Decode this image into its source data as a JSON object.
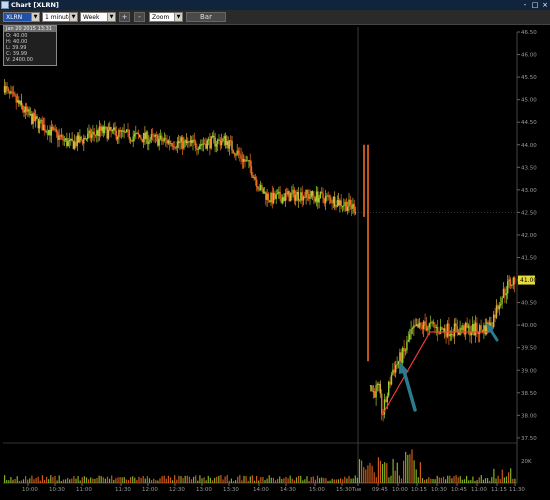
{
  "window": {
    "title": "Chart [XLRN]",
    "controls": [
      "-",
      "□",
      "×"
    ]
  },
  "toolbar": {
    "symbol": "XLRN",
    "interval": "1 minute",
    "range": "Week",
    "plus_label": "+",
    "minus_label": "-",
    "zoom": "Zoom",
    "bar_button": "Bar"
  },
  "ohlc": {
    "header": "Jan 20 2015 13:31",
    "open": "O: 40.00",
    "high": "H: 40.00",
    "low": "L: 39.99",
    "close": "C: 39.99",
    "volume": "V: 2400.00"
  },
  "price_axis": [
    "46.50",
    "46.00",
    "45.50",
    "45.00",
    "44.50",
    "44.00",
    "43.50",
    "43.00",
    "42.50",
    "42.00",
    "41.50",
    "41.00",
    "40.50",
    "40.00",
    "39.50",
    "39.00",
    "38.50",
    "38.00",
    "37.50"
  ],
  "current_price": "41.00",
  "volume_axis_label": "20K",
  "time_axis": [
    "10:00",
    "10:30",
    "11:00",
    "11:30",
    "12:00",
    "12:30",
    "13:00",
    "13:30",
    "14:00",
    "14:30",
    "15:00",
    "15:30",
    "Tue",
    "09:45",
    "10:00",
    "10:15",
    "10:30",
    "10:45",
    "11:00",
    "11:15",
    "11:30"
  ],
  "colors": {
    "up": "#9ace2c",
    "down": "#f06a20",
    "neutral": "#d8b440",
    "annotation_line": "#ff3b3b",
    "annotation_arrow": "#2a7c8c",
    "current_price_bg": "#e8dc3c",
    "titlebar": "#10243e"
  },
  "annotations": [
    {
      "type": "line",
      "name": "rebound-trendline"
    },
    {
      "type": "line",
      "name": "consolidation-line"
    },
    {
      "type": "arrow",
      "name": "arrow-low"
    },
    {
      "type": "arrow",
      "name": "arrow-consolidation"
    }
  ],
  "chart_data": {
    "type": "candlestick",
    "symbol": "XLRN",
    "interval": "1 minute",
    "price_range": [
      37.5,
      46.5
    ],
    "key_prices": {
      "day1_open_area": 45.2,
      "day1_mid_range": 44.0,
      "day1_close": 42.7,
      "day2_open_spike": 44.0,
      "day2_low": 38.0,
      "day2_consolidation": 39.9,
      "last": 41.0
    }
  }
}
